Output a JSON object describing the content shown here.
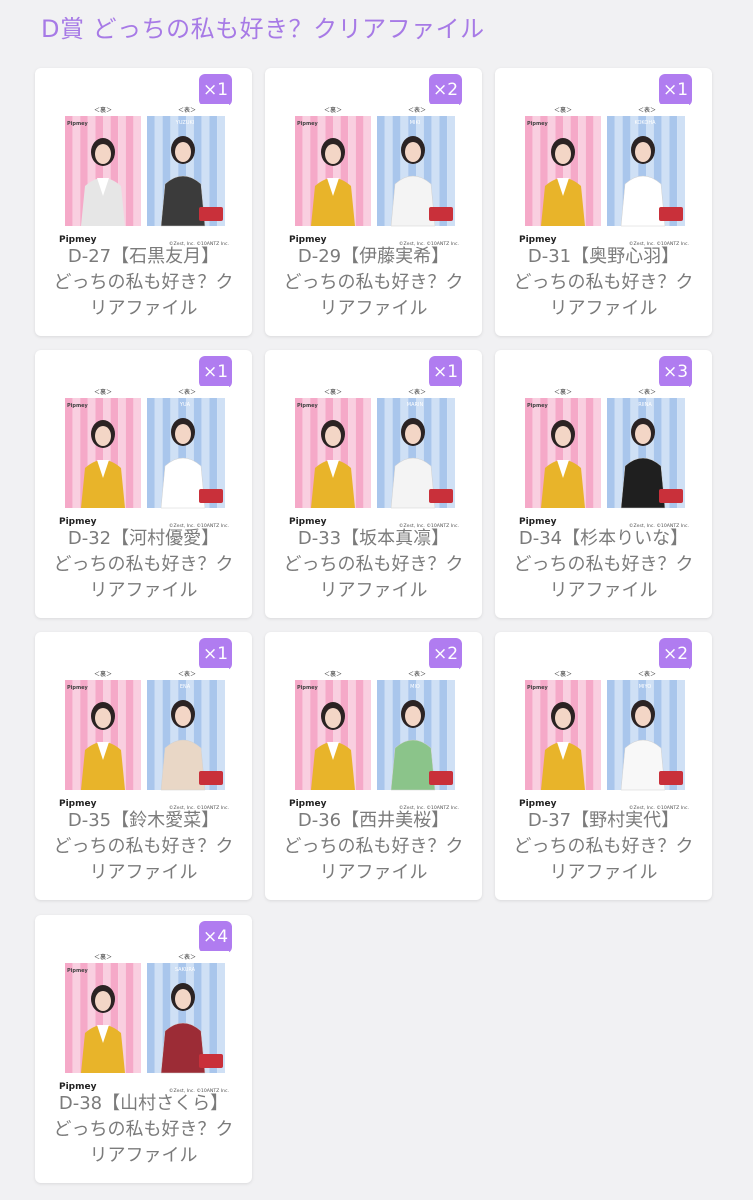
{
  "page": {
    "title": "D賞 どっちの私も好き？クリアファイル"
  },
  "colors": {
    "accent": "#b07cf0",
    "title": "#a77ae6",
    "pink_stripe_a": "#f5a9c8",
    "pink_stripe_b": "#f9cfe0",
    "blue_stripe_a": "#a9c6ec",
    "blue_stripe_b": "#cfe0f5",
    "uniform_yellow": "#e8b42a"
  },
  "common": {
    "back_label": "＜裏＞",
    "front_label": "＜表＞",
    "brand": "Pipmey",
    "copyright": "©Zest, Inc. ©10ANTZ Inc.",
    "caption_line2": "どっちの私も好き？ク",
    "caption_line3": "リアファイル"
  },
  "items": [
    {
      "code": "D-27【石黒友月】",
      "qty": "×1",
      "name_tag": "YUZUKI"
    },
    {
      "code": "D-29【伊藤実希】",
      "qty": "×2",
      "name_tag": "MIKI"
    },
    {
      "code": "D-31【奥野心羽】",
      "qty": "×1",
      "name_tag": "KOKOHA"
    },
    {
      "code": "D-32【河村優愛】",
      "qty": "×1",
      "name_tag": "YUA"
    },
    {
      "code": "D-33【坂本真凛】",
      "qty": "×1",
      "name_tag": "MARIN"
    },
    {
      "code": "D-34【杉本りいな】",
      "qty": "×3",
      "name_tag": "RIINA"
    },
    {
      "code": "D-35【鈴木愛菜】",
      "qty": "×1",
      "name_tag": "ENA"
    },
    {
      "code": "D-36【西井美桜】",
      "qty": "×2",
      "name_tag": "MIO"
    },
    {
      "code": "D-37【野村実代】",
      "qty": "×2",
      "name_tag": "MIYO"
    },
    {
      "code": "D-38【山村さくら】",
      "qty": "×4",
      "name_tag": "SAKURA"
    }
  ]
}
